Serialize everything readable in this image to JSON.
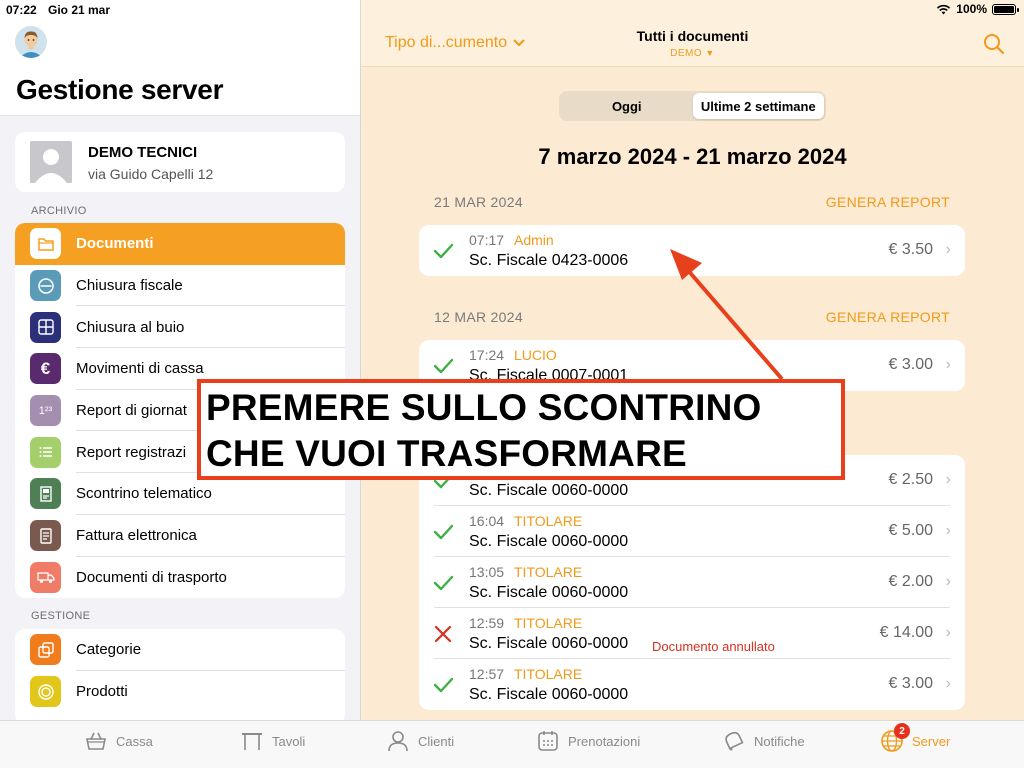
{
  "status_bar": {
    "time": "07:22",
    "date": "Gio 21 mar",
    "battery": "100%"
  },
  "sidebar": {
    "title": "Gestione server",
    "store": {
      "name": "DEMO TECNICI",
      "address": "via Guido Capelli 12"
    },
    "sections": [
      {
        "label": "ARCHIVIO",
        "items": [
          {
            "label": "Documenti",
            "icon": "folder-icon",
            "color": "#f6a023",
            "active": true
          },
          {
            "label": "Chiusura fiscale",
            "icon": "no-entry-icon",
            "color": "#5b9bb8"
          },
          {
            "label": "Chiusura al buio",
            "icon": "grid-icon",
            "color": "#2c2f7a"
          },
          {
            "label": "Movimenti di cassa",
            "icon": "euro-icon",
            "color": "#5a2a6e"
          },
          {
            "label": "Report di giornat",
            "icon": "numbers-icon",
            "color": "#a58fb0"
          },
          {
            "label": "Report registrazi",
            "icon": "list-icon",
            "color": "#a5cf6a"
          },
          {
            "label": "Scontrino telematico",
            "icon": "receipt-icon",
            "color": "#4e7f55"
          },
          {
            "label": "Fattura elettronica",
            "icon": "invoice-icon",
            "color": "#7a5a4e"
          },
          {
            "label": "Documenti di trasporto",
            "icon": "truck-icon",
            "color": "#f07c68"
          }
        ]
      },
      {
        "label": "GESTIONE",
        "items": [
          {
            "label": "Categorie",
            "icon": "copy-icon",
            "color": "#f07c1e"
          },
          {
            "label": "Prodotti",
            "icon": "circle-icon",
            "color": "#e2c619"
          }
        ]
      }
    ]
  },
  "main": {
    "nav": {
      "filter": "Tipo di...cumento",
      "title": "Tutti i documenti",
      "subtitle": "DEMO"
    },
    "segments": [
      {
        "label": "Oggi",
        "selected": false
      },
      {
        "label": "Ultime 2 settimane",
        "selected": true
      }
    ],
    "range": "7 marzo 2024 - 21 marzo 2024",
    "sections": [
      {
        "date": "21 MAR 2024",
        "report": "GENERA REPORT",
        "docs": [
          {
            "time": "07:17",
            "user": "Admin",
            "name": "Sc. Fiscale 0423-0006",
            "amount": "€ 3.50",
            "status": "ok",
            "note": ""
          }
        ]
      },
      {
        "date": "12 MAR 2024",
        "report": "GENERA REPORT",
        "docs": [
          {
            "time": "17:24",
            "user": "LUCIO",
            "name": "Sc. Fiscale 0007-0001",
            "amount": "€ 3.00",
            "status": "ok",
            "note": ""
          }
        ]
      },
      {
        "date": "",
        "report": "",
        "docs": [
          {
            "time": "",
            "user": "",
            "name": "Sc. Fiscale 0060-0000",
            "amount": "€ 2.50",
            "status": "ok",
            "note": ""
          },
          {
            "time": "16:04",
            "user": "TITOLARE",
            "name": "Sc. Fiscale 0060-0000",
            "amount": "€ 5.00",
            "status": "ok",
            "note": ""
          },
          {
            "time": "13:05",
            "user": "TITOLARE",
            "name": "Sc. Fiscale 0060-0000",
            "amount": "€ 2.00",
            "status": "ok",
            "note": ""
          },
          {
            "time": "12:59",
            "user": "TITOLARE",
            "name": "Sc. Fiscale 0060-0000",
            "amount": "€ 14.00",
            "status": "cancelled",
            "note": "Documento annullato"
          },
          {
            "time": "12:57",
            "user": "TITOLARE",
            "name": "Sc. Fiscale 0060-0000",
            "amount": "€ 3.00",
            "status": "ok",
            "note": ""
          }
        ]
      }
    ]
  },
  "callout": {
    "line1": "PREMERE SULLO SCONTRINO",
    "line2": "CHE VUOI TRASFORMARE",
    "color": "#e8401c"
  },
  "tabbar": {
    "items": [
      {
        "label": "Cassa",
        "icon": "basket-icon"
      },
      {
        "label": "Tavoli",
        "icon": "table-icon"
      },
      {
        "label": "Clienti",
        "icon": "person-icon"
      },
      {
        "label": "Prenotazioni",
        "icon": "calendar-icon"
      },
      {
        "label": "Notifiche",
        "icon": "bell-icon"
      },
      {
        "label": "Server",
        "icon": "globe-icon",
        "active": true,
        "badge": "2"
      }
    ]
  },
  "colors": {
    "accent": "#f09a1a",
    "ok": "#3cb043",
    "cancel": "#d83020"
  }
}
